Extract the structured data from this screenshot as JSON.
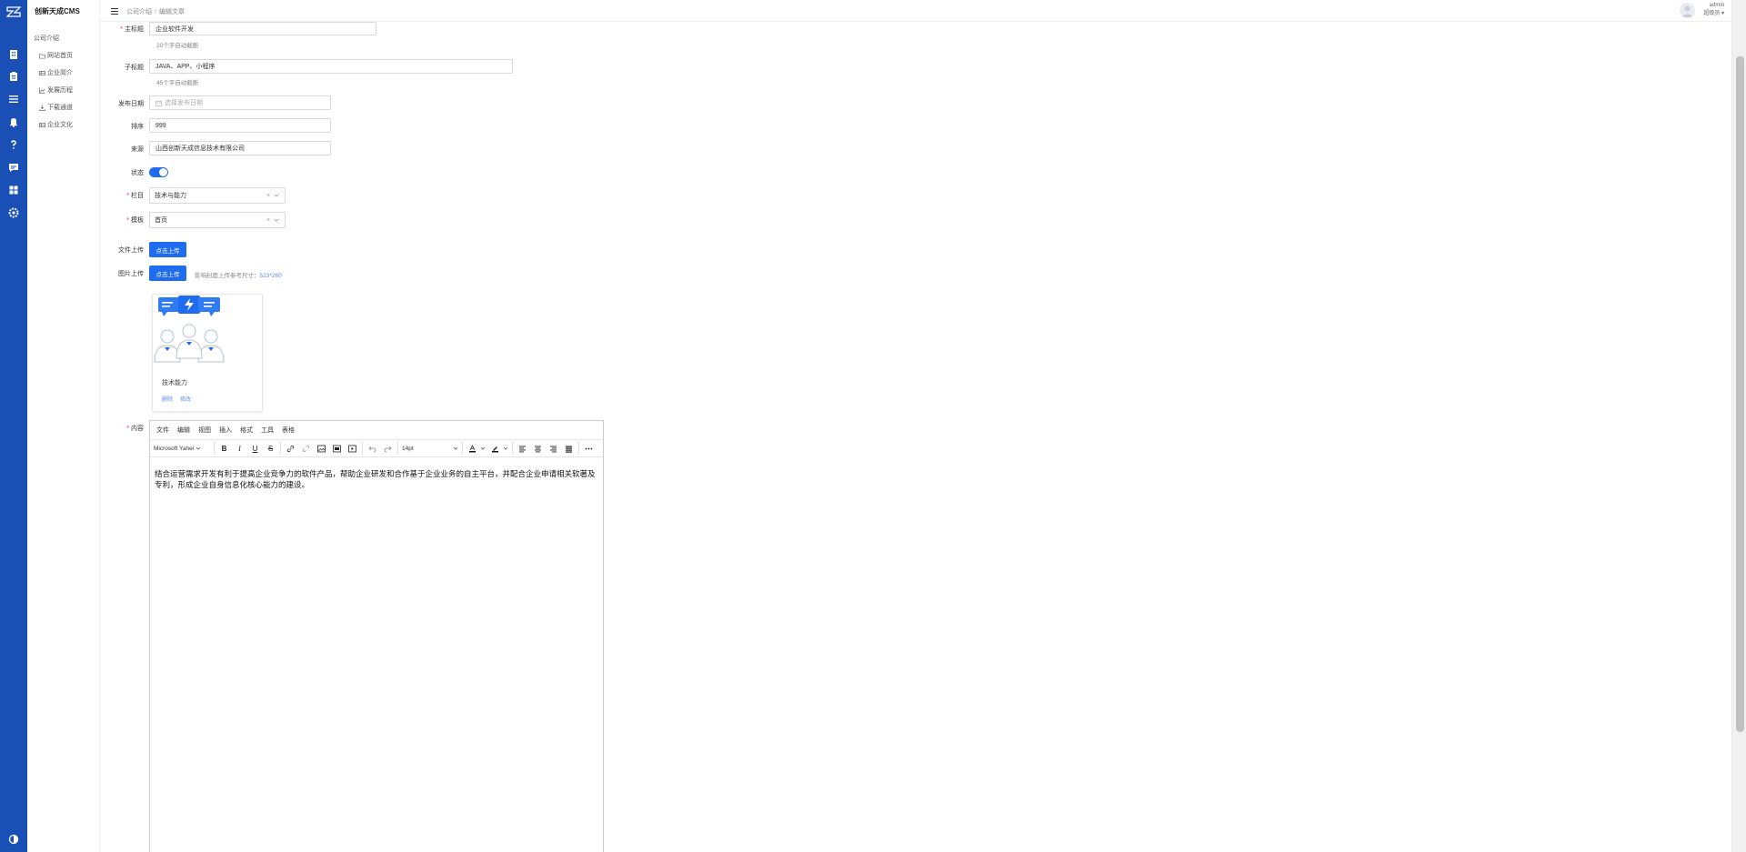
{
  "app": {
    "brand": "创新天成CMS"
  },
  "rail": {
    "icons": [
      "logo-icon",
      "building-icon",
      "clipboard-icon",
      "list-icon",
      "bell-icon",
      "help-icon",
      "chat-icon",
      "grid-icon",
      "settings-icon",
      "theme-icon"
    ]
  },
  "sidebar": {
    "group": "公司介绍",
    "items": [
      {
        "label": "网站首页",
        "icon": "home-icon"
      },
      {
        "label": "企业简介",
        "icon": "table-icon"
      },
      {
        "label": "发展历程",
        "icon": "chart-icon"
      },
      {
        "label": "下载通道",
        "icon": "download-icon"
      },
      {
        "label": "企业文化",
        "icon": "table-icon"
      }
    ]
  },
  "header": {
    "breadcrumb": [
      "公司介绍",
      "编辑文章"
    ],
    "user_name": "admin",
    "user_role": "超级员 ▾"
  },
  "form": {
    "title": {
      "label": "主标题",
      "value": "企业软件开发",
      "hint": "20个字自动截断"
    },
    "subtitle": {
      "label": "子标题",
      "value": "JAVA、APP、小程序",
      "hint": "45个字自动截断"
    },
    "date": {
      "label": "发布日期",
      "placeholder": "选择发布日期"
    },
    "sort": {
      "label": "排序",
      "value": "999"
    },
    "source": {
      "label": "来源",
      "value": "山西创新天成信息技术有限公司"
    },
    "status": {
      "label": "状态",
      "on": true
    },
    "column": {
      "label": "栏目",
      "value": "技术与能力"
    },
    "template": {
      "label": "模板",
      "value": "首页"
    },
    "file_upload": {
      "label": "文件上传",
      "button": "点击上传"
    },
    "image_upload": {
      "label": "图片上传",
      "button": "点击上传",
      "hint_prefix": "影响封面上传参考尺寸：",
      "hint_size": "523*260"
    },
    "image_card": {
      "title": "技术能力",
      "delete": "删除",
      "edit": "修改"
    },
    "content": {
      "label": "内容"
    }
  },
  "editor": {
    "menus": [
      "文件",
      "编辑",
      "视图",
      "插入",
      "格式",
      "工具",
      "表格"
    ],
    "font_family": "Microsoft Yahei",
    "font_size": "14pt",
    "text": "结合运营需求开发有利于提高企业竞争力的软件产品，帮助企业研发和合作基于企业业务的自主平台，并配合企业申请相关软著及专利，形成企业自身信息化核心能力的建设。"
  },
  "colors": {
    "primary": "#1f6cf0",
    "rail": "#1a4fb5",
    "required": "#f5222d"
  }
}
